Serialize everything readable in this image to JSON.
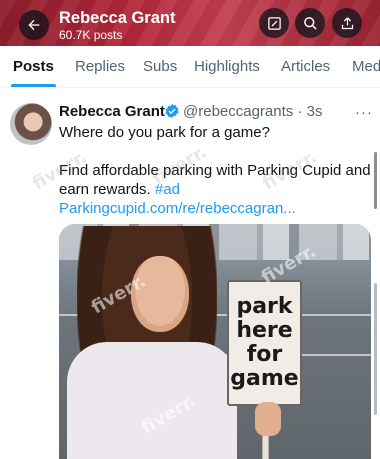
{
  "header": {
    "title": "Rebecca Grant",
    "subtitle": "60.7K posts",
    "back_icon": "back-arrow-icon",
    "edit_icon": "edit-icon",
    "search_icon": "search-icon",
    "share_icon": "share-icon"
  },
  "tabs": [
    "Posts",
    "Replies",
    "Subs",
    "Highlights",
    "Articles",
    "Med"
  ],
  "tweet": {
    "name": "Rebecca Grant",
    "handle": "@rebeccagrants",
    "time": "3s",
    "line1": "Where do you park for a game?",
    "line2": "Find affordable parking with Parking Cupid and",
    "line3_text": "earn rewards.",
    "hashtag": "#ad",
    "link": "Parkingcupid.com/re/rebeccagran...",
    "more": "···"
  },
  "sign_text": "park\nhere\nfor\ngame",
  "watermark": "fiverr.",
  "colors": {
    "accent": "#1d9bf0",
    "header": "#b3283a"
  }
}
